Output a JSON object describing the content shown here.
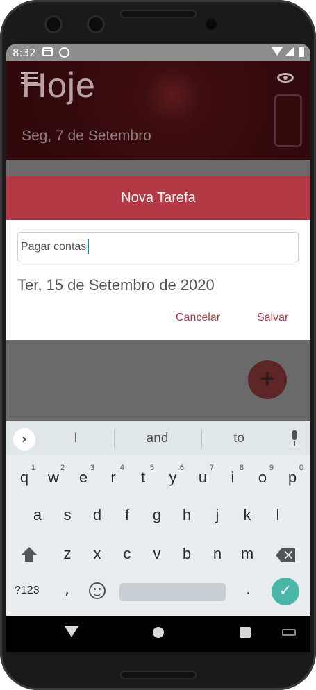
{
  "status_bar": {
    "time": "8:32"
  },
  "app": {
    "title": "Hoje",
    "date": "Seg, 7 de Setembro"
  },
  "dialog": {
    "title": "Nova Tarefa",
    "task_value": "Pagar contas",
    "date_value": "Ter, 15 de Setembro de 2020",
    "cancel_label": "Cancelar",
    "save_label": "Salvar"
  },
  "fab": {
    "label": "+"
  },
  "keyboard": {
    "suggestions": [
      "I",
      "and",
      "to"
    ],
    "row1": [
      {
        "k": "q",
        "n": "1"
      },
      {
        "k": "w",
        "n": "2"
      },
      {
        "k": "e",
        "n": "3"
      },
      {
        "k": "r",
        "n": "4"
      },
      {
        "k": "t",
        "n": "5"
      },
      {
        "k": "y",
        "n": "6"
      },
      {
        "k": "u",
        "n": "7"
      },
      {
        "k": "i",
        "n": "8"
      },
      {
        "k": "o",
        "n": "9"
      },
      {
        "k": "p",
        "n": "0"
      }
    ],
    "row2": [
      "a",
      "s",
      "d",
      "f",
      "g",
      "h",
      "j",
      "k",
      "l"
    ],
    "row3": [
      "z",
      "x",
      "c",
      "v",
      "b",
      "n",
      "m"
    ],
    "num_label": "?123",
    "comma": ",",
    "period": "."
  },
  "colors": {
    "accent": "#b33a45",
    "enter_key": "#4ab6a8"
  }
}
